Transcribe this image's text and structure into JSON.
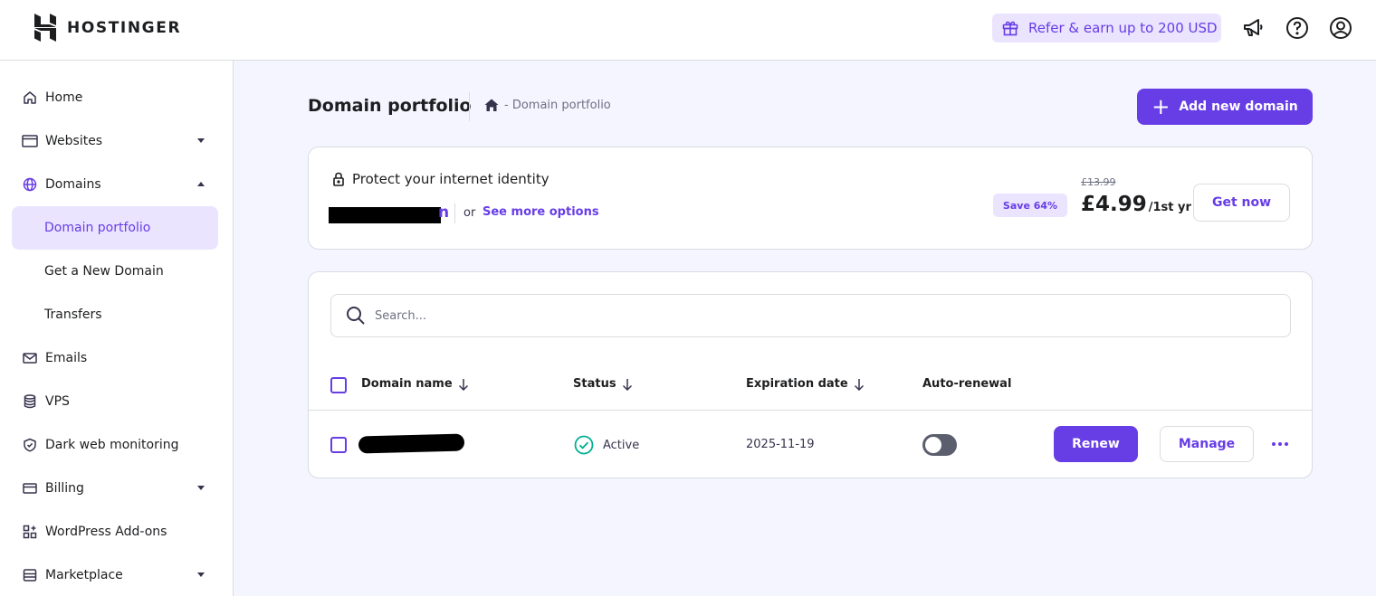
{
  "header": {
    "brand": "HOSTINGER",
    "refer_label": "Refer & earn up to 200 USD",
    "icons": [
      "gift-icon",
      "megaphone-icon",
      "help-icon",
      "account-icon"
    ]
  },
  "sidebar": {
    "items": [
      {
        "label": "Home",
        "icon": "home-icon"
      },
      {
        "label": "Websites",
        "icon": "browser-icon"
      },
      {
        "label": "Domains",
        "icon": "globe-icon"
      },
      {
        "label": "Domain portfolio"
      },
      {
        "label": "Get a New Domain"
      },
      {
        "label": "Transfers"
      },
      {
        "label": "Emails",
        "icon": "mail-icon"
      },
      {
        "label": "VPS",
        "icon": "database-icon"
      },
      {
        "label": "Dark web monitoring",
        "icon": "shield-icon"
      },
      {
        "label": "Billing",
        "icon": "card-icon"
      },
      {
        "label": "WordPress Add-ons",
        "icon": "addons-icon"
      },
      {
        "label": "Marketplace",
        "icon": "store-icon"
      }
    ]
  },
  "main": {
    "title": "Domain portfolio",
    "breadcrumb": "- Domain portfolio",
    "add_button": "Add new domain",
    "promo": {
      "title": "Protect your internet identity",
      "domain_tail": "n",
      "or_text": "or",
      "more_link": "See more options",
      "save_badge": "Save 64%",
      "old_price": "£13.99",
      "price": "£4.99",
      "price_period": "/1st yr",
      "cta": "Get now"
    },
    "search": {
      "placeholder": "Search..."
    },
    "table": {
      "columns": [
        "Domain name",
        "Status",
        "Expiration date",
        "Auto-renewal"
      ],
      "rows": [
        {
          "status": "Active",
          "expiration": "2025-11-19",
          "auto_renewal": false
        }
      ],
      "renew_label": "Renew",
      "manage_label": "Manage"
    }
  },
  "colors": {
    "accent": "#673de6",
    "accent_light": "#ebe4ff",
    "success": "#00b090",
    "background": "#f4f5ff"
  }
}
